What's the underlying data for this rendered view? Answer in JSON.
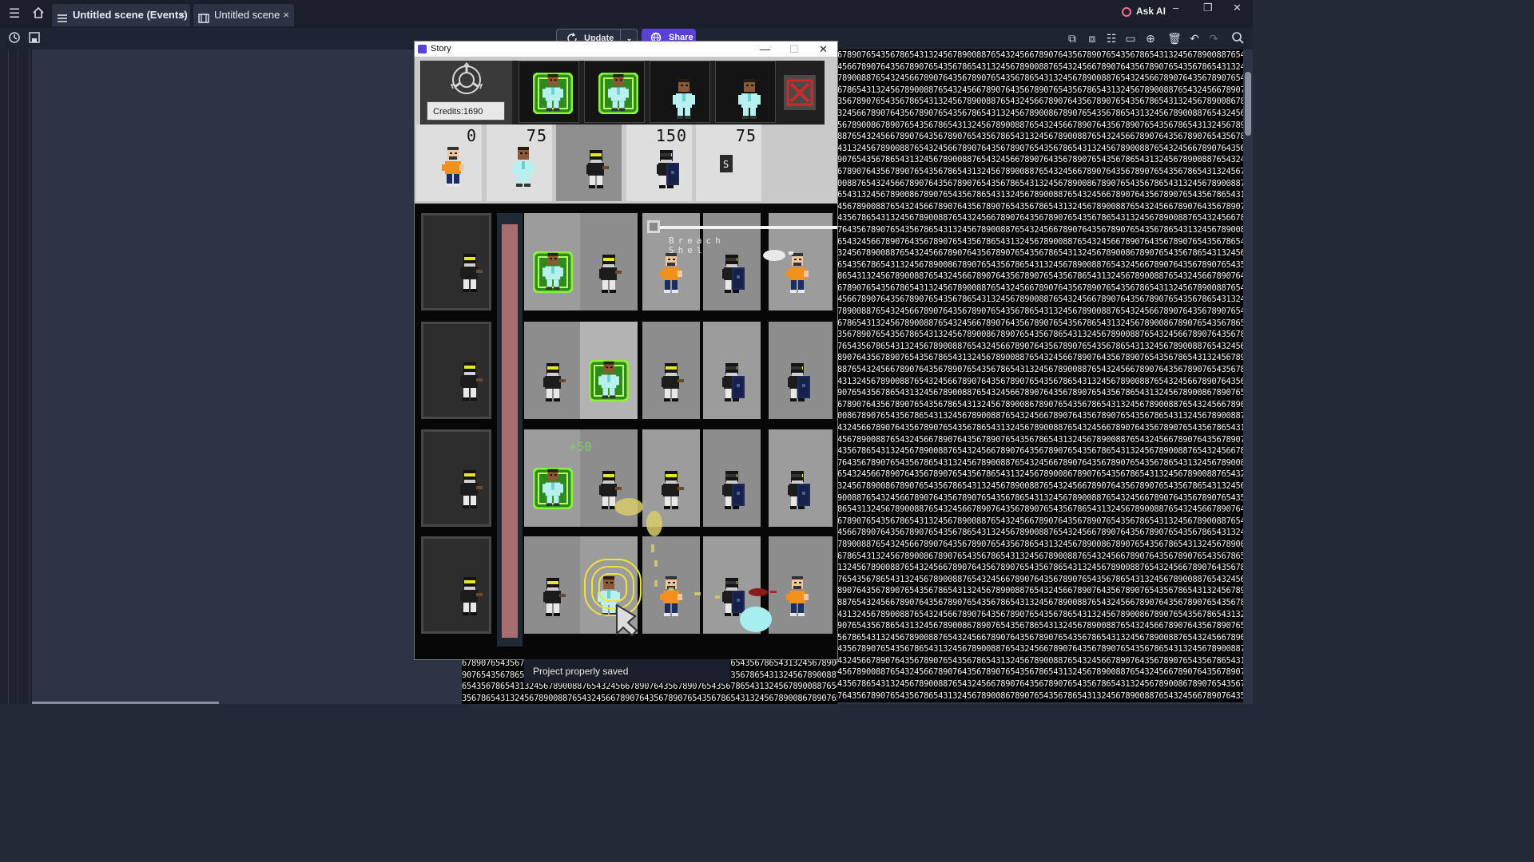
{
  "app": {
    "tabs": [
      {
        "label": "Untitled scene (Events)",
        "close": "×"
      },
      {
        "label": "Untitled scene",
        "close": "×"
      }
    ],
    "ask_ai": "Ask AI",
    "window_controls": {
      "minimize": "–",
      "maximize": "❐",
      "close": "✕"
    }
  },
  "toolbar": {
    "update_label": "Update",
    "share_label": "Share",
    "dropdown_glyph": "⌄"
  },
  "story_window": {
    "title": "Story",
    "controls": {
      "minimize": "—",
      "maximize": "☐",
      "close": "✕"
    },
    "credits": "Credits:1690",
    "shop_prices": [
      "0",
      "75",
      "",
      "150",
      "75"
    ],
    "breach_text": [
      "Breach",
      "Shel"
    ],
    "plus_text": "+50"
  },
  "toast": {
    "message": "Project properly saved"
  },
  "digits": {
    "seed": "67890765435678654313245678900887654324566789076435678907654356786543132456789008876543245667890764356789076543567865431324567890088765432456678907643567890765435678654313245678900887654324566789076435678907654356786543132456789008"
  }
}
